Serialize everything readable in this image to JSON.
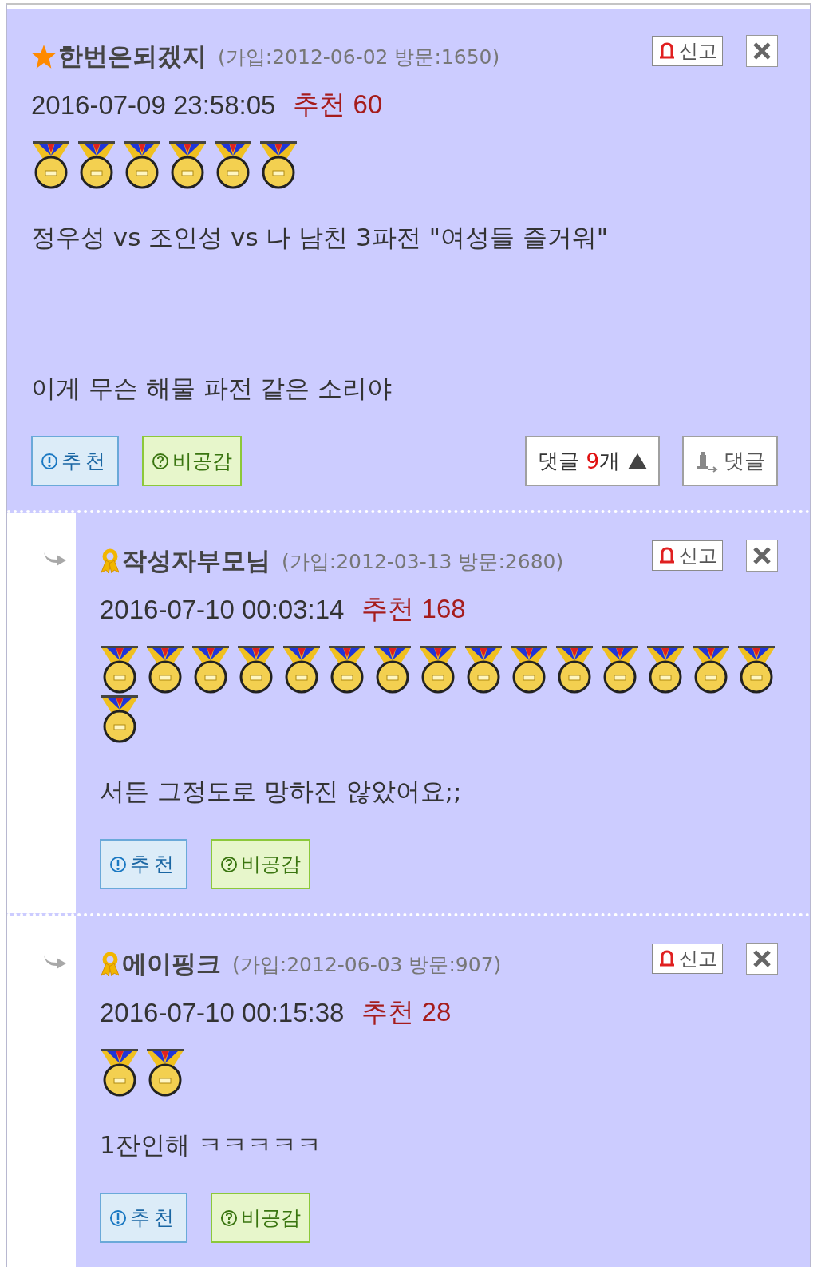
{
  "comments": [
    {
      "kind": "comment",
      "nickname": "한번은되겠지",
      "meta": "(가입:2012-06-02 방문:1650)",
      "report": "신고",
      "date": "2016-07-09 23:58:05",
      "recommend_label": "추천",
      "recommend_count": "60",
      "medals": [
        {
          "kind": "medal"
        },
        {
          "kind": "medal"
        },
        {
          "kind": "medal"
        },
        {
          "kind": "medal"
        },
        {
          "kind": "medal"
        },
        {
          "kind": "medal"
        }
      ],
      "body": "정우성 vs 조인성 vs 나 남친 3파전 \"여성들 즐거워\"\n\n\n이게 무슨 해물 파전 같은 소리야",
      "like": "추천",
      "dislike": "비공감",
      "reply_toggle": {
        "label": "댓글",
        "count": "9",
        "unit": "개",
        "expanded": true
      },
      "reply_button": "댓글"
    },
    {
      "kind": "reply",
      "nickname": "작성자부모님",
      "meta": "(가입:2012-03-13 방문:2680)",
      "report": "신고",
      "date": "2016-07-10 00:03:14",
      "recommend_label": "추천",
      "recommend_count": "168",
      "medals": [
        {
          "kind": "medal"
        },
        {
          "kind": "medal"
        },
        {
          "kind": "medal"
        },
        {
          "kind": "medal"
        },
        {
          "kind": "medal"
        },
        {
          "kind": "medal"
        },
        {
          "kind": "medal"
        },
        {
          "kind": "medal"
        },
        {
          "kind": "medal"
        },
        {
          "kind": "medal"
        },
        {
          "kind": "medal"
        },
        {
          "kind": "medal"
        },
        {
          "kind": "medal"
        },
        {
          "kind": "medal"
        },
        {
          "kind": "medal"
        },
        {
          "kind": "medal"
        }
      ],
      "body": "서든 그정도로 망하진 않았어요;;",
      "like": "추천",
      "dislike": "비공감"
    },
    {
      "kind": "reply",
      "nickname": "에이핑크",
      "meta": "(가입:2012-06-03 방문:907)",
      "report": "신고",
      "date": "2016-07-10 00:15:38",
      "recommend_label": "추천",
      "recommend_count": "28",
      "medals": [
        {
          "kind": "medal"
        },
        {
          "kind": "medal"
        }
      ],
      "body": "1잔인해 ㅋㅋㅋㅋㅋ",
      "like": "추천",
      "dislike": "비공감"
    }
  ]
}
